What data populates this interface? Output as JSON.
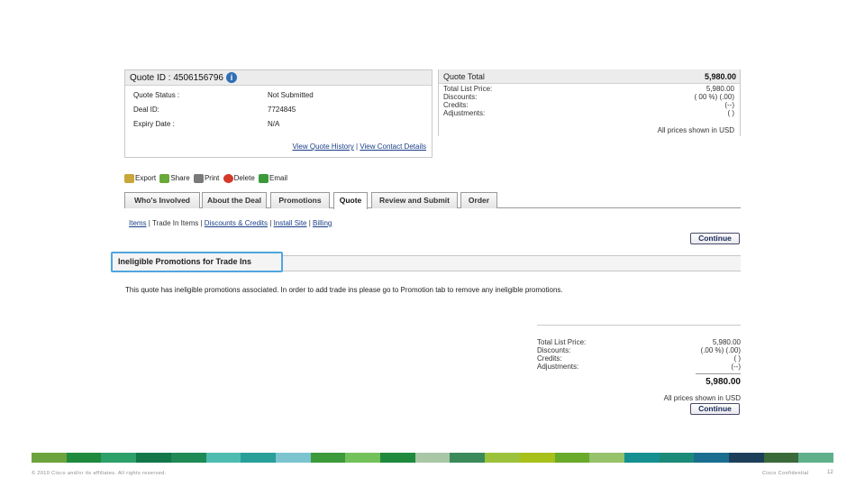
{
  "quote_info": {
    "title": "Quote ID : 4506156796",
    "info_icon": "i",
    "rows": [
      {
        "label": "Quote Status :",
        "value": "Not Submitted"
      },
      {
        "label": "Deal ID:",
        "value": "7724845"
      },
      {
        "label": "Expiry Date :",
        "value": "N/A"
      }
    ],
    "link_history": "View Quote History",
    "link_separator": "|",
    "link_contact": "View Contact Details"
  },
  "quote_total": {
    "title": "Quote Total",
    "amount": "5,980.00",
    "rows": [
      {
        "label": "Total List Price:",
        "value": "5,980.00"
      },
      {
        "label": "Discounts:",
        "value": "( 00 %) (.00)"
      },
      {
        "label": "Credits:",
        "value": "(--)"
      },
      {
        "label": "Adjustments:",
        "value": "( )"
      }
    ],
    "currency_note": "All prices shown in USD"
  },
  "toolbar": {
    "items": [
      {
        "label": "Export",
        "icon": "export-icon",
        "color": "#c9a53a"
      },
      {
        "label": "Share",
        "icon": "share-icon",
        "color": "#6aa83a"
      },
      {
        "label": "Print",
        "icon": "print-icon",
        "color": "#7a7a7a"
      },
      {
        "label": "Delete",
        "icon": "delete-icon",
        "color": "#d33a2a"
      },
      {
        "label": "Email",
        "icon": "email-icon",
        "color": "#3a9a3a"
      }
    ]
  },
  "tabs": [
    {
      "label": "Who's Involved"
    },
    {
      "label": "About the Deal"
    },
    {
      "label": "Promotions"
    },
    {
      "label": "Quote",
      "active": true
    },
    {
      "label": "Review and Submit"
    },
    {
      "label": "Order"
    }
  ],
  "sublinks": {
    "items_label": "Items",
    "sep1": "|",
    "trade_in_label": "Trade In Items",
    "sep2": "|",
    "discounts_label": "Discounts & Credits",
    "sep3": "|",
    "install_label": "Install Site",
    "sep4": "|",
    "billing_label": "Billing"
  },
  "continue_label": "Continue",
  "section_title": "Ineligible Promotions for Trade Ins",
  "message": "This quote has ineligible promotions associated. In order to add trade ins please go to Promotion tab to remove any ineligible promotions.",
  "summary": {
    "rows": [
      {
        "label": "Total List Price:",
        "value": "5,980.00"
      },
      {
        "label": "Discounts:",
        "value": "(.00 %) (.00)"
      },
      {
        "label": "Credits:",
        "value": "( )"
      },
      {
        "label": "Adjustments:",
        "value": "(--)"
      }
    ],
    "total": "5,980.00",
    "currency_note": "All prices shown in USD"
  },
  "footer": {
    "copyright": "© 2010 Cisco and/or its affiliates. All rights reserved.",
    "confidential": "Cisco Confidential",
    "page_number": "12",
    "stripe_colors": [
      "#6da33d",
      "#1f8a3d",
      "#2ea06a",
      "#13774a",
      "#1f8a55",
      "#4ebcb0",
      "#2a9f9a",
      "#7cc4d0",
      "#3c9a3a",
      "#73c15a",
      "#1f8a3d",
      "#a9c6a6",
      "#3b8a5a",
      "#9cc23b",
      "#a8c01a",
      "#6aaa2a",
      "#96c26a",
      "#159090",
      "#1c8a78",
      "#1a6e90",
      "#1d3f5a",
      "#3a6a3a",
      "#5fb08a"
    ]
  }
}
